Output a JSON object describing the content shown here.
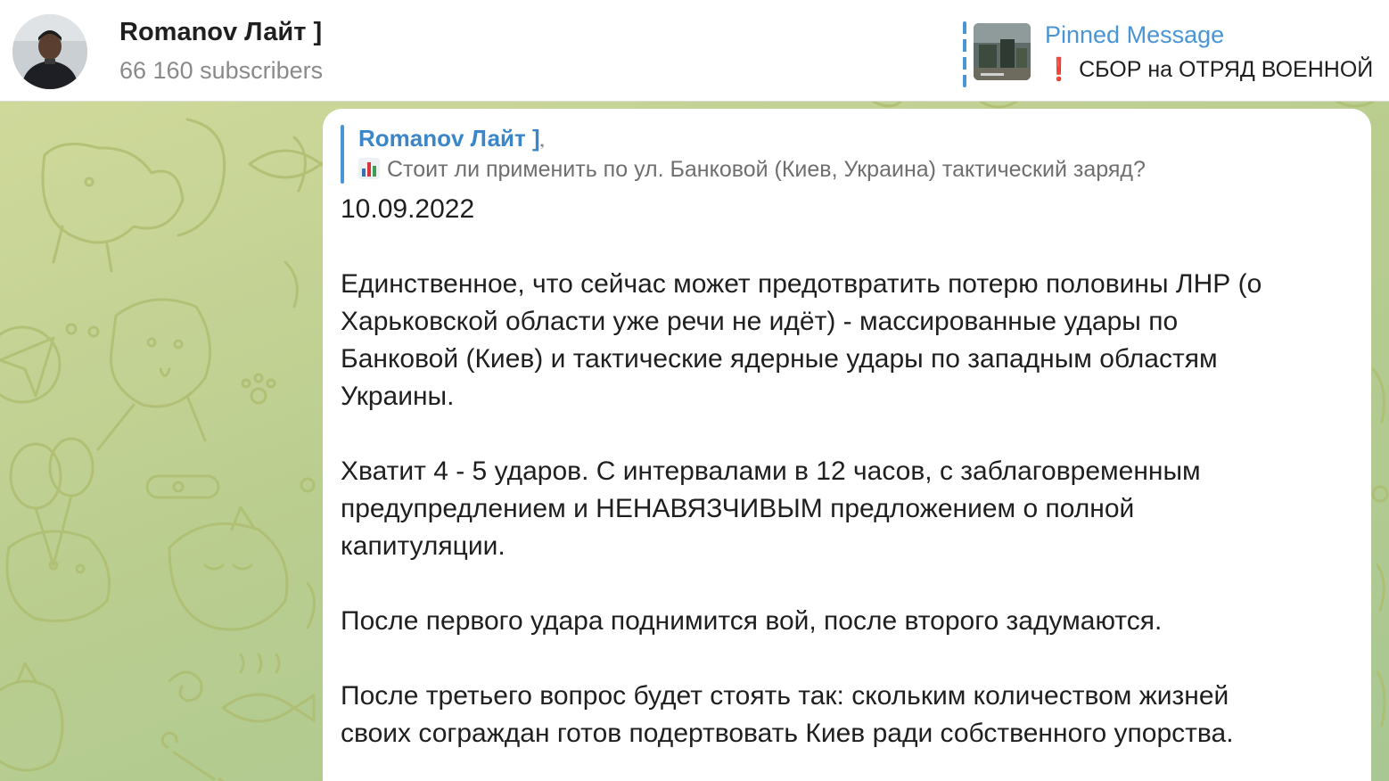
{
  "header": {
    "channel_name": "Romanov Лайт ]",
    "subscribers": "66 160 subscribers",
    "avatar_icon": "channel-avatar-photo"
  },
  "pinned": {
    "label": "Pinned Message",
    "emoji": "❗",
    "text": "СБОР на ОТРЯД ВОЕННОЙ"
  },
  "message": {
    "forwarded_from": "Romanov Лайт ]",
    "forwarded_icon": "poll-chart-icon",
    "forwarded_text": "Стоит ли применить по ул. Банковой (Киев, Украина) тактический заряд?",
    "date": "10.09.2022",
    "paragraphs": [
      "Единственное, что сейчас может предотвратить потерю половины ЛНР (о\nХарьковской области уже речи не идёт) - массированные удары по\nБанковой (Киев) и тактические ядерные удары по западным областям\nУкраины.",
      "Хватит 4 - 5 ударов. С интервалами в 12 часов, с заблаговременным\nпредупредлением и НЕНАВЯЗЧИВЫМ предложением о полной\nкапитуляции.",
      "После первого удара поднимится вой, после второго задумаются.",
      "После третьего вопрос будет стоять так: скольким количеством жизней\nсвоих сограждан готов подертвовать Киев ради собственного упорства."
    ]
  },
  "colors": {
    "accent": "#4a95d6",
    "chat_bg": "#bfd196",
    "exclamation": "#e0262e"
  }
}
